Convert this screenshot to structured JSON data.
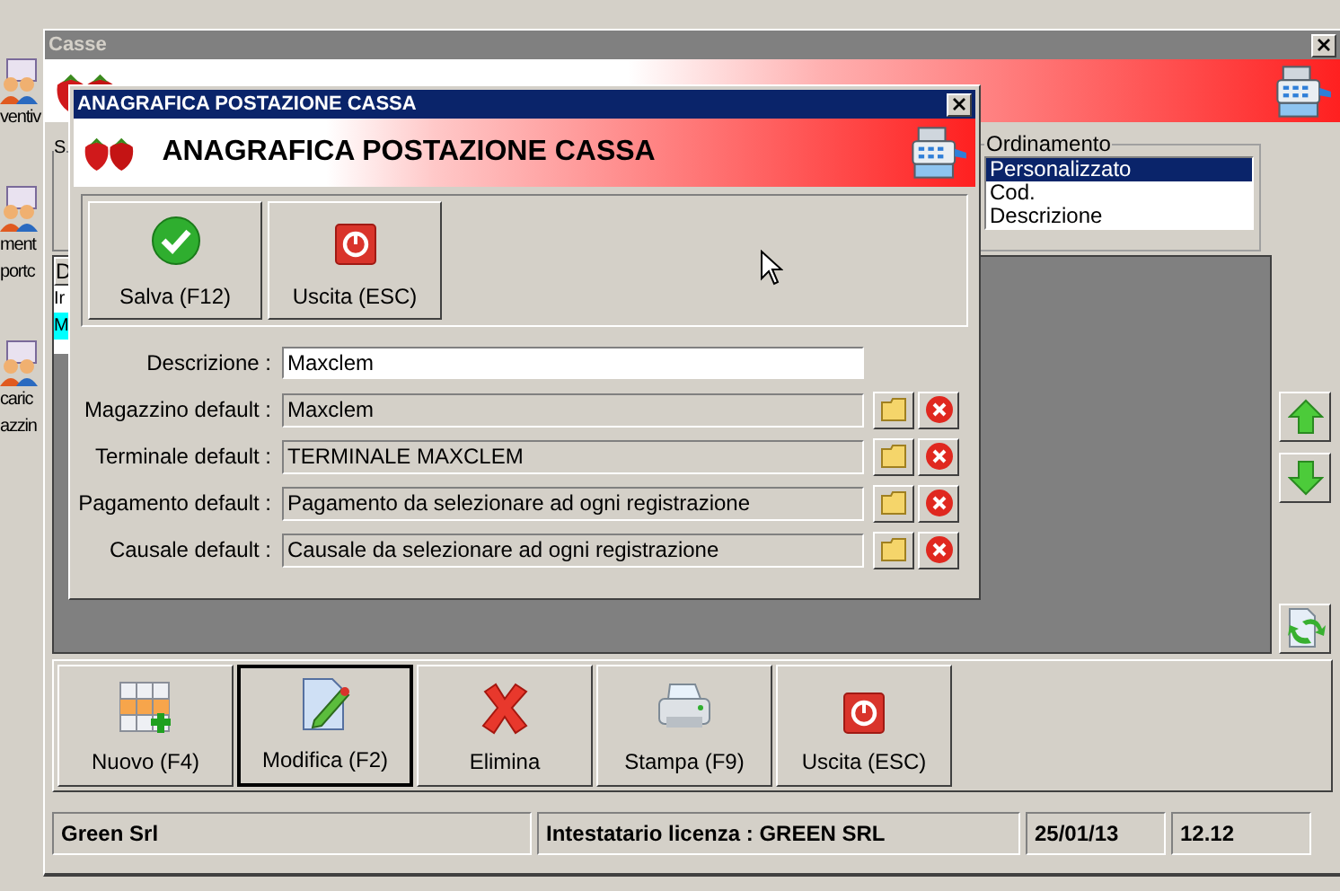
{
  "desktop_icons": [
    {
      "kind": "people",
      "lines": [
        "ventiv"
      ]
    },
    {
      "kind": "people",
      "lines": [
        "ment",
        "portc"
      ]
    },
    {
      "kind": "people",
      "lines": [
        "caric",
        "azzin"
      ]
    }
  ],
  "main_window": {
    "title": "Casse",
    "left_group": {
      "label": "S"
    },
    "ordering": {
      "title": "Ordinamento",
      "items": [
        {
          "label": "Personalizzato",
          "selected": true
        },
        {
          "label": "Cod.",
          "selected": false
        },
        {
          "label": "Descrizione",
          "selected": false
        }
      ]
    },
    "list": {
      "header": "D",
      "rows": [
        {
          "text": "Ir",
          "selected": false
        },
        {
          "text": "M",
          "selected": true
        }
      ]
    },
    "side_buttons": [
      {
        "kind": "up"
      },
      {
        "kind": "down"
      },
      {
        "kind": "refresh"
      }
    ],
    "toolbar": [
      {
        "kind": "new",
        "label": "Nuovo (F4)",
        "focused": false
      },
      {
        "kind": "edit",
        "label": "Modifica (F2)",
        "focused": true
      },
      {
        "kind": "delete",
        "label": "Elimina",
        "focused": false
      },
      {
        "kind": "print",
        "label": "Stampa (F9)",
        "focused": false
      },
      {
        "kind": "exit",
        "label": "Uscita (ESC)",
        "focused": false
      }
    ],
    "status_bar": [
      "Green Srl",
      "Intestatario licenza : GREEN SRL",
      "25/01/13",
      "12.12"
    ]
  },
  "dialog": {
    "title": "ANAGRAFICA POSTAZIONE CASSA",
    "header": "ANAGRAFICA POSTAZIONE CASSA",
    "buttons": [
      {
        "kind": "save",
        "label": "Salva (F12)"
      },
      {
        "kind": "exit",
        "label": "Uscita (ESC)"
      }
    ],
    "fields": [
      {
        "kind": "text",
        "label": "Descrizione :",
        "value": "Maxclem"
      },
      {
        "kind": "lookup",
        "label": "Magazzino default :",
        "value": "Maxclem"
      },
      {
        "kind": "lookup",
        "label": "Terminale default :",
        "value": "TERMINALE MAXCLEM"
      },
      {
        "kind": "lookup",
        "label": "Pagamento default :",
        "value": "Pagamento da selezionare ad ogni registrazione"
      },
      {
        "kind": "lookup",
        "label": "Causale default :",
        "value": "Causale da selezionare ad ogni registrazione"
      }
    ]
  }
}
